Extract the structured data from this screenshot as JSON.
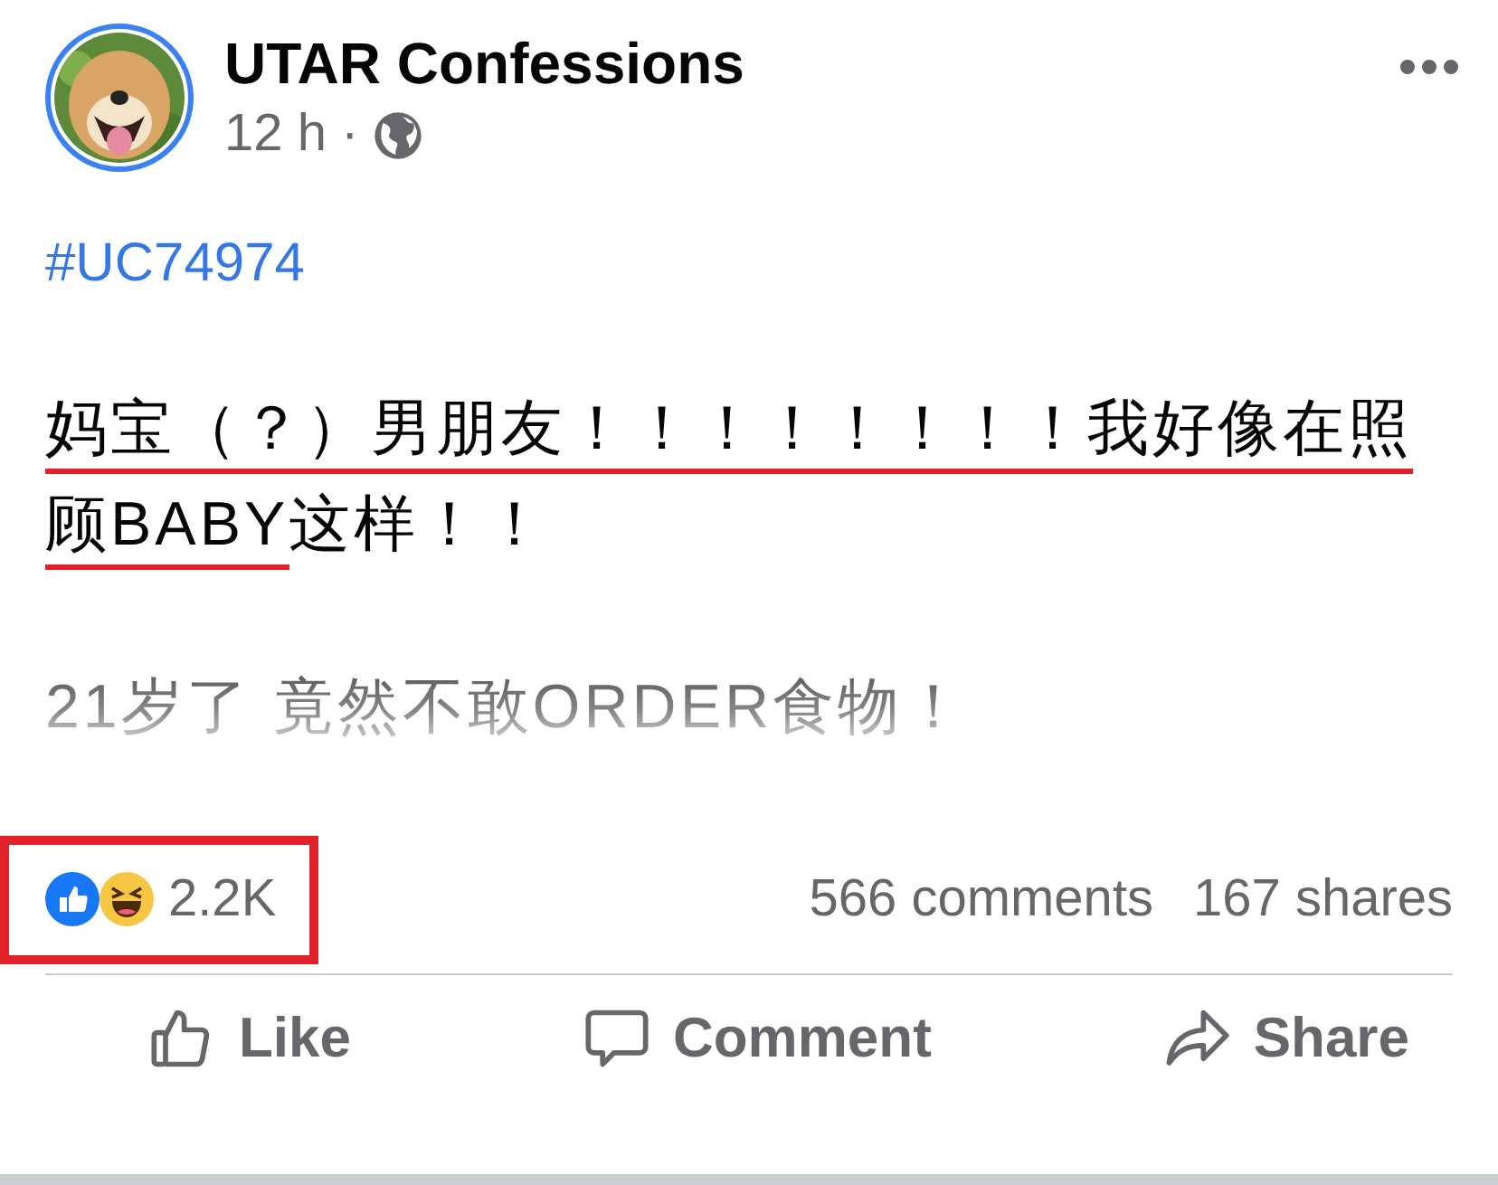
{
  "post": {
    "author": "UTAR Confessions",
    "time": "12 h",
    "separator": "·",
    "public": true,
    "hashtag": "#UC74974",
    "paragraphs": [
      {
        "faded": false,
        "lines": [
          [
            {
              "text": "妈宝（？）男朋友！！！！！！！！我好像在照",
              "underlined": true
            }
          ],
          [
            {
              "text": "顾BABY",
              "underlined": true
            },
            {
              "text": "这样！！",
              "underlined": false
            }
          ]
        ]
      },
      {
        "faded": true,
        "lines": [
          [
            {
              "text": "21岁了 竟然不敢ORDER食物！",
              "underlined": false
            }
          ]
        ]
      }
    ]
  },
  "stats": {
    "reactions": "2.2K",
    "highlighted": true,
    "comments": "566 comments",
    "shares": "167 shares"
  },
  "actions": [
    {
      "kind": "like",
      "label": "Like"
    },
    {
      "kind": "comment",
      "label": "Comment"
    },
    {
      "kind": "share",
      "label": "Share"
    }
  ]
}
